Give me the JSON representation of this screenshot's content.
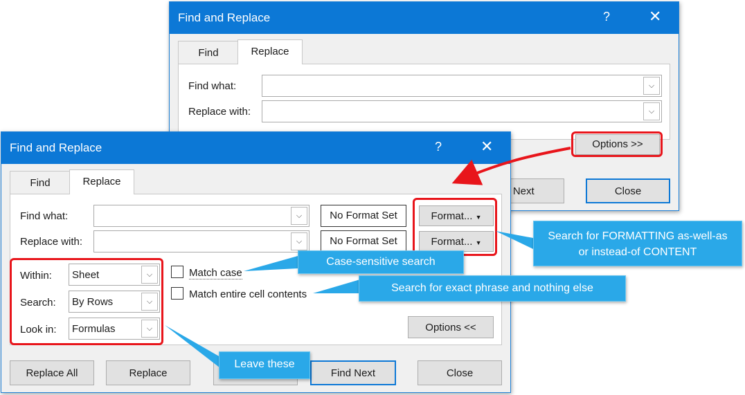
{
  "back_dialog": {
    "title": "Find and Replace",
    "help": "?",
    "close_glyph": "✕",
    "tabs": [
      "Find",
      "Replace"
    ],
    "find_label": "Find what:",
    "replace_label": "Replace with:",
    "options_button": "Options >>",
    "find_next_partial": "d Next",
    "close_button": "Close"
  },
  "front_dialog": {
    "title": "Find and Replace",
    "help": "?",
    "close_glyph": "✕",
    "tabs": [
      "Find",
      "Replace"
    ],
    "find_label": "Find what:",
    "replace_label": "Replace with:",
    "no_format_1": "No Format Set",
    "no_format_2": "No Format Set",
    "format_1": "Format...",
    "format_2": "Format...",
    "within_label": "Within:",
    "within_value": "Sheet",
    "search_label": "Search:",
    "search_value": "By Rows",
    "lookin_label": "Look in:",
    "lookin_value": "Formulas",
    "match_case": "Match case",
    "match_entire": "Match entire cell contents",
    "options_button": "Options <<",
    "replace_all": "Replace All",
    "replace": "Replace",
    "find_next": "Find Next",
    "close": "Close"
  },
  "callouts": {
    "formatting": "Search for FORMATTING as-well-as or instead-of CONTENT",
    "case": "Case-sensitive search",
    "exact": "Search for exact phrase and nothing else",
    "leave": "Leave these"
  },
  "colors": {
    "titlebar": "#0c78d6",
    "callout": "#2aa8e8",
    "highlight": "#e8151b"
  }
}
